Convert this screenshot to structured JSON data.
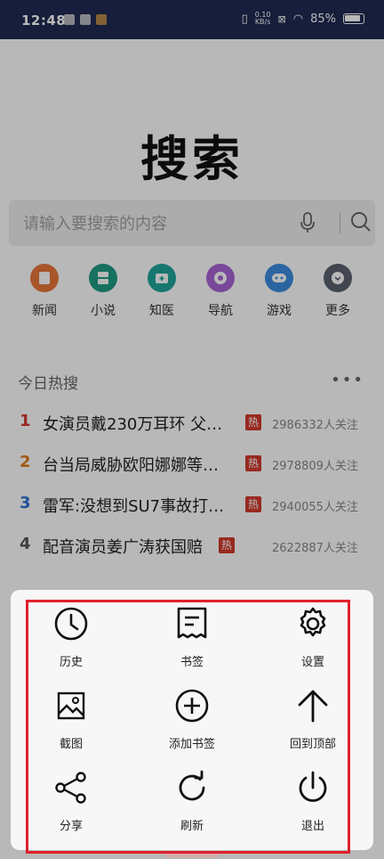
{
  "status_bar": {
    "time": "12:48",
    "net_speed_top": "0.10",
    "net_speed_bottom": "KB/s",
    "battery": "85%"
  },
  "page": {
    "title": "搜索",
    "search": {
      "placeholder": "请输入要搜索的内容",
      "mic_icon": "microphone-icon",
      "search_icon": "search-icon"
    },
    "quick_links": [
      {
        "label": "新闻",
        "color": "#e8773a",
        "icon": "news-icon"
      },
      {
        "label": "小说",
        "color": "#1f9b86",
        "icon": "book-icon"
      },
      {
        "label": "知医",
        "color": "#1fa69a",
        "icon": "medical-kit-icon"
      },
      {
        "label": "导航",
        "color": "#a864d6",
        "icon": "compass-icon"
      },
      {
        "label": "游戏",
        "color": "#3c8de0",
        "icon": "gamepad-icon"
      },
      {
        "label": "更多",
        "color": "#5a6270",
        "icon": "chevron-down-icon"
      }
    ],
    "hot_search": {
      "title": "今日热搜",
      "more": "•••",
      "badge": "热",
      "items": [
        {
          "rank": "1",
          "text": "女演员戴230万耳环 父…",
          "count": "2986332人关注",
          "rank_color": "#d33a2c"
        },
        {
          "rank": "2",
          "text": "台当局威胁欧阳娜娜等…",
          "count": "2978809人关注",
          "rank_color": "#e07a1a"
        },
        {
          "rank": "3",
          "text": "雷军:没想到SU7事故打…",
          "count": "2940055人关注",
          "rank_color": "#2f6fd6"
        },
        {
          "rank": "4",
          "text": "配音演员姜广涛获国赔",
          "count": "2622887人关注",
          "rank_color": "#555555"
        }
      ]
    }
  },
  "menu": {
    "items": [
      {
        "label": "历史",
        "icon": "clock-icon"
      },
      {
        "label": "书签",
        "icon": "bookmark-receipt-icon"
      },
      {
        "label": "设置",
        "icon": "gear-icon"
      },
      {
        "label": "截图",
        "icon": "image-icon"
      },
      {
        "label": "添加书签",
        "icon": "add-circle-icon"
      },
      {
        "label": "回到顶部",
        "icon": "arrow-up-icon"
      },
      {
        "label": "分享",
        "icon": "share-icon"
      },
      {
        "label": "刷新",
        "icon": "refresh-icon"
      },
      {
        "label": "退出",
        "icon": "power-icon"
      }
    ]
  },
  "colors": {
    "highlight": "#e0202c",
    "status_bar": "#1f2a52",
    "hot_badge": "#d33a2c"
  }
}
